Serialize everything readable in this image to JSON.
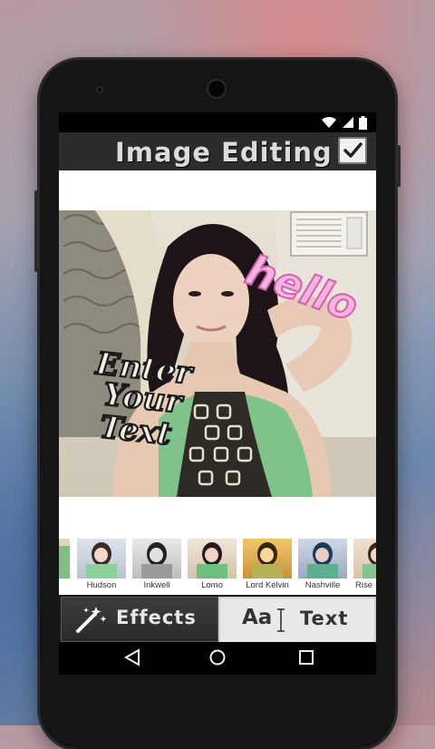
{
  "app": {
    "title": "Image Editing",
    "confirm_icon": "check-icon"
  },
  "status_bar": {
    "icons": [
      "wifi-icon",
      "signal-icon",
      "battery-icon"
    ]
  },
  "canvas": {
    "stickers": {
      "hello": "hello",
      "line1": "Enter",
      "line2": "Your",
      "line3": "Text"
    }
  },
  "filters": {
    "items": [
      {
        "label": ""
      },
      {
        "label": "Hudson"
      },
      {
        "label": "Inkwell"
      },
      {
        "label": "Lomo"
      },
      {
        "label": "Lord Kelvin"
      },
      {
        "label": "Nashville"
      },
      {
        "label": "Rise"
      }
    ]
  },
  "tabs": {
    "effects": "Effects",
    "text": "Text",
    "text_icon": "Aa"
  },
  "nav": {
    "back": "back-icon",
    "home": "home-icon",
    "recents": "recents-icon"
  },
  "colors": {
    "appbar": "#2c2c2c",
    "hello_pink": "#e872c0",
    "sticker_text": "#1a1a1a"
  }
}
